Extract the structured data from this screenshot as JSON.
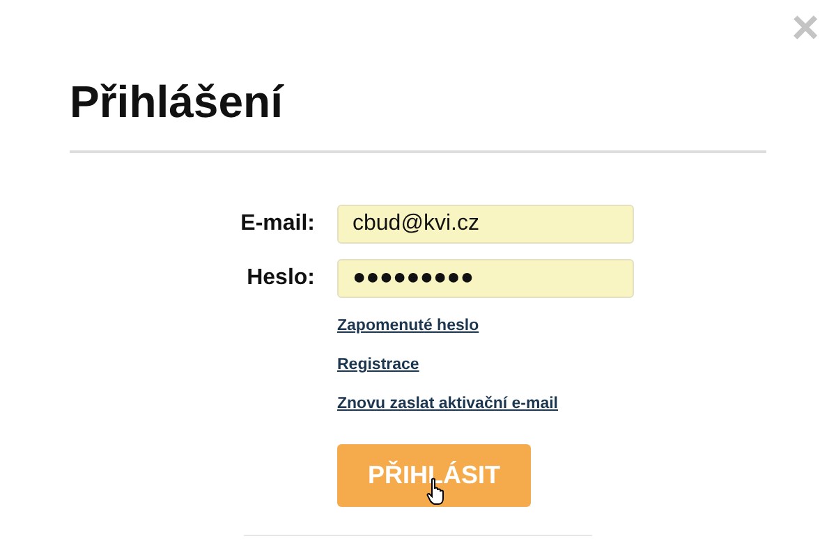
{
  "dialog": {
    "title": "Přihlášení",
    "close": "×"
  },
  "form": {
    "fields": [
      {
        "label": "E-mail:",
        "value": "cbud@kvi.cz"
      },
      {
        "label": "Heslo:",
        "value": "●●●●●●●●●"
      }
    ],
    "links": [
      "Zapomenuté heslo",
      "Registrace",
      "Znovu zaslat aktivační e-mail"
    ],
    "submit": "PŘIHLÁSIT"
  }
}
